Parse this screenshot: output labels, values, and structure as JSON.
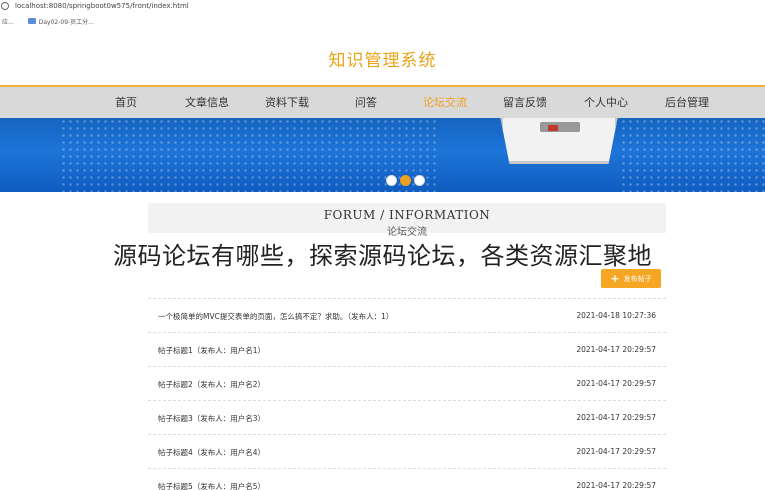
{
  "browser": {
    "url": "localhost:8080/springboot0w575/front/index.html",
    "bookmarks_apps": "应...",
    "bookmark_folder": "Day02-09-员工分..."
  },
  "site": {
    "title": "知识管理系统"
  },
  "nav": {
    "items": [
      {
        "label": "首页"
      },
      {
        "label": "文章信息"
      },
      {
        "label": "资料下载"
      },
      {
        "label": "问答"
      },
      {
        "label": "论坛交流"
      },
      {
        "label": "留言反馈"
      },
      {
        "label": "个人中心"
      },
      {
        "label": "后台管理"
      }
    ],
    "active_index": 4
  },
  "colors": {
    "accent": "#f0a020",
    "title": "#e8a317",
    "banner": "#1e74d8",
    "nav_bg": "#d9d9d9",
    "button": "#f5a623"
  },
  "banner": {
    "active_slide_index": 1,
    "slide_count": 3
  },
  "forum": {
    "title_en": "FORUM / INFORMATION",
    "title_cn": "论坛交流",
    "overlay_caption": "源码论坛有哪些，探索源码论坛，各类资源汇聚地",
    "post_button_label": "发布帖子",
    "posts": [
      {
        "title": "一个极简单的MVC提交表单的页面，怎么搞不定？求助。（发布人：1）",
        "date": "2021-04-18 10:27:36"
      },
      {
        "title": "帖子标题1（发布人：用户名1）",
        "date": "2021-04-17 20:29:57"
      },
      {
        "title": "帖子标题2（发布人：用户名2）",
        "date": "2021-04-17 20:29:57"
      },
      {
        "title": "帖子标题3（发布人：用户名3）",
        "date": "2021-04-17 20:29:57"
      },
      {
        "title": "帖子标题4（发布人：用户名4）",
        "date": "2021-04-17 20:29:57"
      },
      {
        "title": "帖子标题5（发布人：用户名5）",
        "date": "2021-04-17 20:29:57"
      }
    ]
  }
}
